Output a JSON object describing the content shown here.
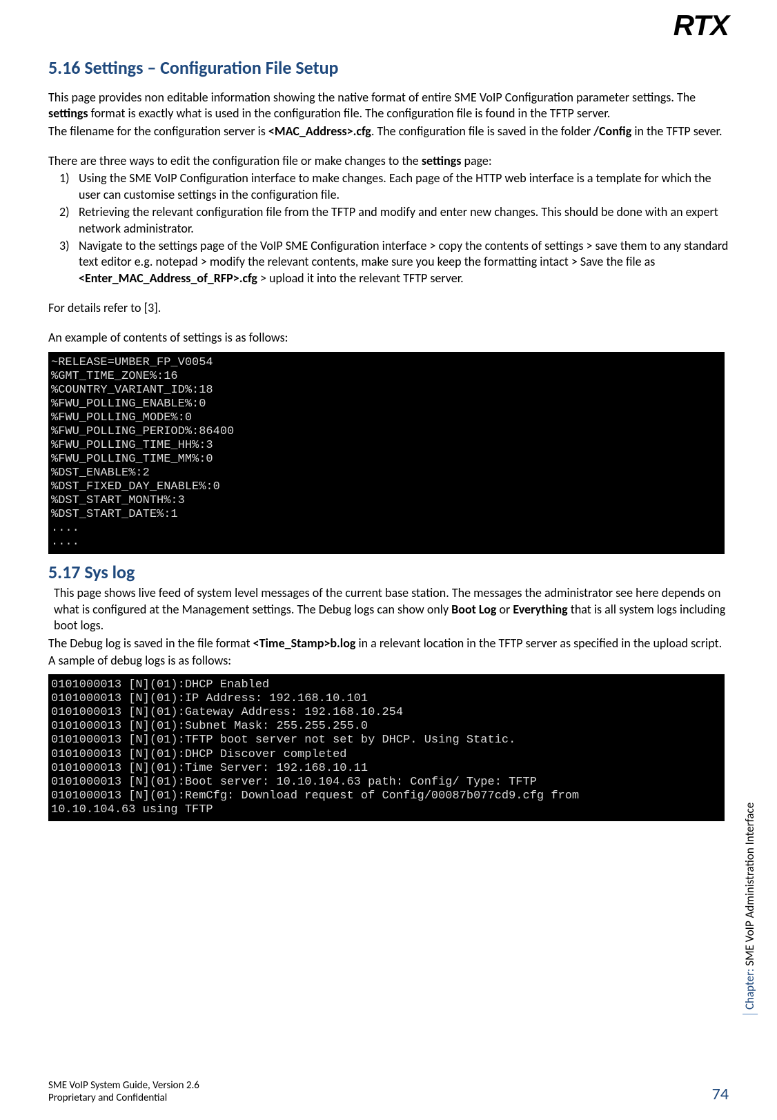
{
  "logo": "RTX",
  "h1_516": "5.16 Settings – Configuration File Setup",
  "p1a": "This page provides non editable information showing the native format of entire SME VoIP Configuration parameter settings. The ",
  "p1b_bold": "settings",
  "p1c": " format is exactly what is used in the configuration file. The configuration file is found in the TFTP server.",
  "p2a": "The filename for the configuration server is ",
  "p2b_bold": "<MAC_Address>.cfg",
  "p2c": ". The configuration file is saved in the folder ",
  "p2d_bold": "/Config",
  "p2e": " in the TFTP sever.",
  "p3a": "There are three ways to edit the configuration file or make changes to the ",
  "p3b_bold": "settings",
  "p3c": " page:",
  "li1": "Using the SME VoIP Configuration interface to make changes. Each page of the HTTP web interface is a template for which the user can customise settings in the configuration file.",
  "li2": "Retrieving the relevant configuration file from the TFTP and modify and enter new changes. This should be done with an expert network administrator.",
  "li3a": "Navigate to the settings page of the VoIP SME Configuration interface > copy the contents of settings > save them to any standard text editor e.g. notepad > modify the relevant contents, make sure you keep the formatting intact > Save the file as ",
  "li3b_bold": "<Enter_MAC_Address_of_RFP>.cfg",
  "li3c": " > upload it into the relevant TFTP server.",
  "p4": "For details refer to [3].",
  "p5": "An example of contents of settings is as follows:",
  "code1": "~RELEASE=UMBER_FP_V0054\n%GMT_TIME_ZONE%:16\n%COUNTRY_VARIANT_ID%:18\n%FWU_POLLING_ENABLE%:0\n%FWU_POLLING_MODE%:0\n%FWU_POLLING_PERIOD%:86400\n%FWU_POLLING_TIME_HH%:3\n%FWU_POLLING_TIME_MM%:0\n%DST_ENABLE%:2\n%DST_FIXED_DAY_ENABLE%:0\n%DST_START_MONTH%:3\n%DST_START_DATE%:1\n....\n....",
  "h1_517": "5.17 Sys log",
  "p6a": "This page shows live feed of system level messages of the current base station. The messages the administrator see here depends on what is configured at the Management settings. The Debug logs can show only ",
  "p6b_bold": "Boot Log",
  "p6c": " or ",
  "p6d_bold": "Everything",
  "p6e": " that is all system logs including boot logs.",
  "p7a": "The Debug log is saved in the file format ",
  "p7b_bold": "<Time_Stamp>b.log",
  "p7c": " in a relevant location in the TFTP server as specified in the upload script.",
  "p8": "A sample of debug logs is as follows:",
  "code2": "0101000013 [N](01):DHCP Enabled\n0101000013 [N](01):IP Address: 192.168.10.101\n0101000013 [N](01):Gateway Address: 192.168.10.254\n0101000013 [N](01):Subnet Mask: 255.255.255.0\n0101000013 [N](01):TFTP boot server not set by DHCP. Using Static.\n0101000013 [N](01):DHCP Discover completed\n0101000013 [N](01):Time Server: 192.168.10.11\n0101000013 [N](01):Boot server: 10.10.104.63 path: Config/ Type: TFTP\n0101000013 [N](01):RemCfg: Download request of Config/00087b077cd9.cfg from\n10.10.104.63 using TFTP",
  "side_chapter_label": "Chapter:",
  "side_chapter_name": " SME VoIP Administration Interface",
  "footer1": "SME VoIP System Guide, Version 2.6",
  "footer2": "Proprietary and Confidential",
  "page_number": "74"
}
